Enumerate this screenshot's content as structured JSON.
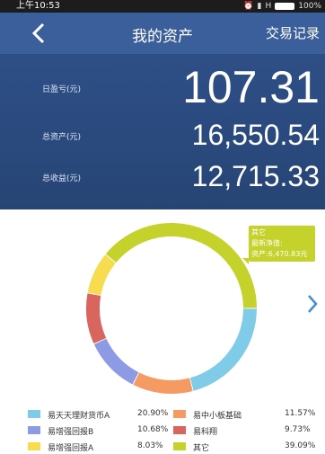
{
  "status_bar": {
    "time": "上午10:53",
    "network": "H",
    "battery": "100%"
  },
  "header": {
    "title": "我的资产",
    "trade_records": "交易记录",
    "back_icon": "chevron-left-icon"
  },
  "summary": {
    "daily_profit": {
      "label": "日盈亏(元)",
      "value": "107.31"
    },
    "total_assets": {
      "label": "总资产(元)",
      "value": "16,550.54"
    },
    "total_income": {
      "label": "总收益(元)",
      "value": "12,715.33"
    }
  },
  "tooltip": {
    "line1": "其它",
    "line2": "最新净值:",
    "line3": "资产:6,470.83元"
  },
  "colors": {
    "header_bg": "#3b5f9a",
    "summary_bg": "#2a4a7e",
    "accent_blue": "#3a8fd6"
  },
  "chart_data": {
    "type": "pie",
    "donut": true,
    "highlighted": "其它",
    "series": [
      {
        "name": "易天天理财货币A",
        "value": 20.9,
        "color": "#7fcbe8"
      },
      {
        "name": "易中小板基础",
        "value": 11.57,
        "color": "#f59a62"
      },
      {
        "name": "易增强回报B",
        "value": 10.68,
        "color": "#8c9be3"
      },
      {
        "name": "易科翔",
        "value": 9.73,
        "color": "#d9655f"
      },
      {
        "name": "易增强回报A",
        "value": 8.03,
        "color": "#f7dc4f"
      },
      {
        "name": "其它",
        "value": 39.09,
        "color": "#c4d22b"
      }
    ]
  },
  "legend": [
    {
      "name": "易天天理财货币A",
      "pct": "20.90%",
      "color": "#7fcbe8"
    },
    {
      "name": "易中小板基础",
      "pct": "11.57%",
      "color": "#f59a62"
    },
    {
      "name": "易增强回报B",
      "pct": "10.68%",
      "color": "#8c9be3"
    },
    {
      "name": "易科翔",
      "pct": "9.73%",
      "color": "#d9655f"
    },
    {
      "name": "易增强回报A",
      "pct": "8.03%",
      "color": "#f7dc4f"
    },
    {
      "name": "其它",
      "pct": "39.09%",
      "color": "#c4d22b"
    }
  ]
}
